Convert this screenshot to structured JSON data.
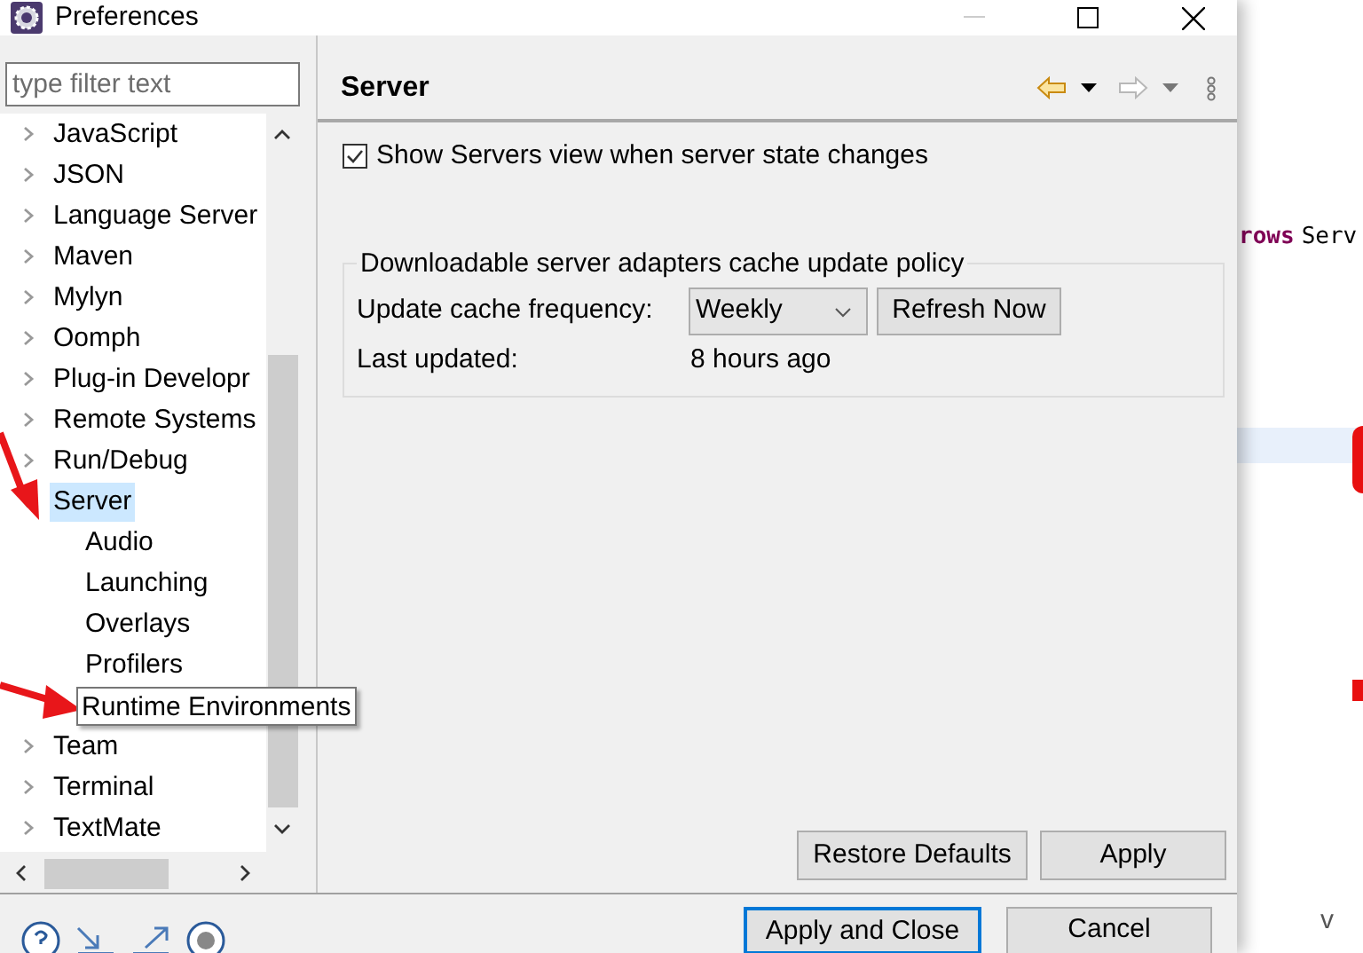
{
  "window": {
    "title": "Preferences"
  },
  "filter": {
    "placeholder": "type filter text"
  },
  "tree": [
    {
      "label": "JavaScript",
      "expanded": false,
      "selected": false,
      "hovered": false
    },
    {
      "label": "JSON",
      "expanded": false,
      "selected": false,
      "hovered": false
    },
    {
      "label": "Language Server",
      "expanded": false,
      "selected": false,
      "hovered": false
    },
    {
      "label": "Maven",
      "expanded": false,
      "selected": false,
      "hovered": false
    },
    {
      "label": "Mylyn",
      "expanded": false,
      "selected": false,
      "hovered": false
    },
    {
      "label": "Oomph",
      "expanded": false,
      "selected": false,
      "hovered": false
    },
    {
      "label": "Plug-in Developr",
      "expanded": false,
      "selected": false,
      "hovered": false
    },
    {
      "label": "Remote Systems",
      "expanded": false,
      "selected": false,
      "hovered": false
    },
    {
      "label": "Run/Debug",
      "expanded": false,
      "selected": false,
      "hovered": false
    },
    {
      "label": "Server",
      "expanded": true,
      "selected": true,
      "hovered": false,
      "children": [
        {
          "label": "Audio",
          "selected": false,
          "hovered": false
        },
        {
          "label": "Launching",
          "selected": false,
          "hovered": false
        },
        {
          "label": "Overlays",
          "selected": false,
          "hovered": false
        },
        {
          "label": "Profilers",
          "selected": false,
          "hovered": false
        },
        {
          "label": "Runtime Environments",
          "selected": false,
          "hovered": true
        }
      ]
    },
    {
      "label": "Team",
      "expanded": false,
      "selected": false,
      "hovered": false
    },
    {
      "label": "Terminal",
      "expanded": false,
      "selected": false,
      "hovered": false
    },
    {
      "label": "TextMate",
      "expanded": false,
      "selected": false,
      "hovered": false
    }
  ],
  "page": {
    "title": "Server",
    "show_servers_view": {
      "label": "Show Servers view when server state changes",
      "checked": true
    },
    "cache_group": {
      "title": "Downloadable server adapters cache update policy",
      "frequency_label": "Update cache frequency:",
      "frequency_value": "Weekly",
      "refresh_button": "Refresh Now",
      "last_updated_label": "Last updated:",
      "last_updated_value": "8 hours ago"
    },
    "buttons": [
      "Restore Defaults",
      "Apply"
    ]
  },
  "dialog_buttons": [
    {
      "label": "Apply and Close",
      "default": true
    },
    {
      "label": "Cancel",
      "default": false
    }
  ],
  "background_editor": {
    "keyword": "rows",
    "text": "Serv",
    "bottom_text": "v"
  }
}
